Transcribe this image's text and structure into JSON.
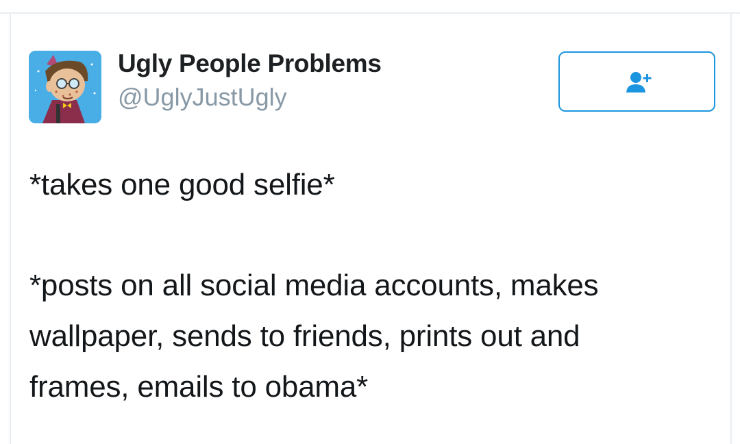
{
  "tweet": {
    "author": {
      "display_name": "Ugly People Problems",
      "handle": "@UglyJustUgly",
      "avatar_icon": "cartoon-avatar-icon"
    },
    "follow_button": {
      "icon": "add-user-icon"
    },
    "text": {
      "line_1": "*takes one good selfie*",
      "paragraph_2": {
        "line_1": "*posts on all social media accounts, makes",
        "line_2": "wallpaper, sends to friends, prints out and",
        "line_3": "frames, emails to obama*"
      }
    }
  },
  "colors": {
    "accent": "#1b95e0",
    "name_text": "#1c2022",
    "handle_text": "#8899a6",
    "body_text": "#14171a",
    "divider": "#e8edf1",
    "avatar_bg": "#4aaee6"
  }
}
